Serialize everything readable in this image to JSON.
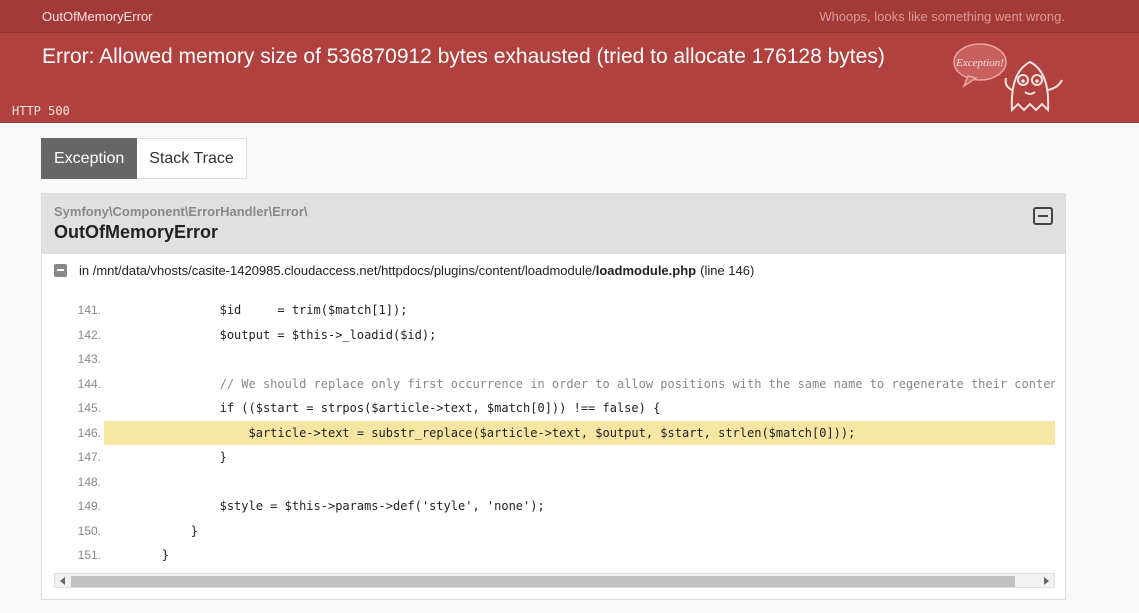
{
  "header": {
    "exception_class": "OutOfMemoryError",
    "http_code": "HTTP 500",
    "http_message": "Whoops, looks like something went wrong.",
    "error_message": "Error: Allowed memory size of 536870912 bytes exhausted (tried to allocate 176128 bytes)",
    "ghost_text": "Exception!"
  },
  "tabs": [
    {
      "label": "Exception",
      "active": true
    },
    {
      "label": "Stack Trace",
      "active": false
    }
  ],
  "panel": {
    "namespace": "Symfony\\Component\\ErrorHandler\\Error\\",
    "exception_name": "OutOfMemoryError",
    "file_prefix": "in /mnt/data/vhosts/casite-1420985.cloudaccess.net/httpdocs/plugins/content/loadmodule/",
    "file_name": "loadmodule.php",
    "line_ref": "(line 146)"
  },
  "code_lines": [
    {
      "num": "141.",
      "text": "                $id     = trim($match[1]);"
    },
    {
      "num": "142.",
      "text": "                $output = $this->_loadid($id);"
    },
    {
      "num": "143.",
      "text": ""
    },
    {
      "num": "144.",
      "text": "                // We should replace only first occurrence in order to allow positions with the same name to regenerate their conten",
      "comment": true
    },
    {
      "num": "145.",
      "text": "                if (($start = strpos($article->text, $match[0])) !== false) {"
    },
    {
      "num": "146.",
      "text": "                    $article->text = substr_replace($article->text, $output, $start, strlen($match[0]));",
      "highlight": true
    },
    {
      "num": "147.",
      "text": "                }"
    },
    {
      "num": "148.",
      "text": ""
    },
    {
      "num": "149.",
      "text": "                $style = $this->params->def('style', 'none');"
    },
    {
      "num": "150.",
      "text": "            }"
    },
    {
      "num": "151.",
      "text": "        }"
    }
  ],
  "colors": {
    "header_bg": "#b0413e",
    "highlight_bg": "#f7e6a3",
    "active_tab_bg": "#666666"
  }
}
